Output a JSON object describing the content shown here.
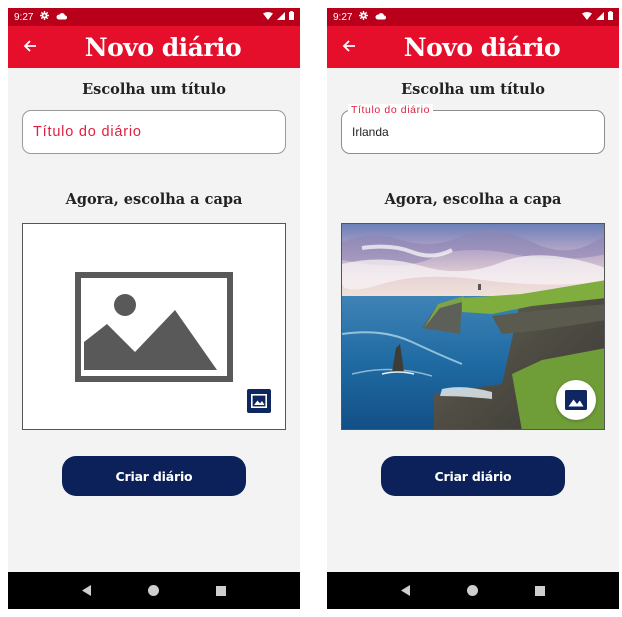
{
  "colors": {
    "status_bar": "#b8001b",
    "app_bar": "#e60f2b",
    "accent_label": "#e02040",
    "primary_button": "#0c2159",
    "nav_bar": "#000000",
    "background": "#f3f3f3"
  },
  "screens": [
    {
      "status": {
        "time": "9:27"
      },
      "app_bar": {
        "title": "Novo diário",
        "back_icon": "arrow-back-icon"
      },
      "title_section": {
        "label": "Escolha um título",
        "placeholder": "Título do diário",
        "value": ""
      },
      "cover_section": {
        "label": "Agora, escolha a capa",
        "state": "empty",
        "pick_icon": "image-icon"
      },
      "create_button": {
        "label": "Criar diário"
      },
      "nav": [
        "back-icon",
        "home-icon",
        "recents-icon"
      ]
    },
    {
      "status": {
        "time": "9:27"
      },
      "app_bar": {
        "title": "Novo diário",
        "back_icon": "arrow-back-icon"
      },
      "title_section": {
        "label": "Escolha um título",
        "floating_label": "Título do diário",
        "value": "Irlanda"
      },
      "cover_section": {
        "label": "Agora, escolha a capa",
        "state": "photo-of-sea-cliffs",
        "pick_icon": "image-icon"
      },
      "create_button": {
        "label": "Criar diário"
      },
      "nav": [
        "back-icon",
        "home-icon",
        "recents-icon"
      ]
    }
  ]
}
